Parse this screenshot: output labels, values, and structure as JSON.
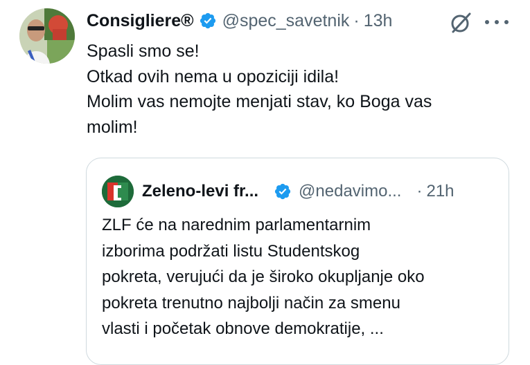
{
  "tweet": {
    "author": {
      "display_name": "Consigliere®",
      "handle": "@spec_savetnik",
      "separator": "·",
      "time": "13h",
      "verified": true,
      "avatar_icon": "profile-photo"
    },
    "text_lines": [
      "Spasli smo se!",
      "Otkad ovih nema u opoziciji idila!",
      "Molim vas nemojte menjati stav, ko Boga vas",
      "molim!"
    ],
    "actions": {
      "grok_icon": "grok-icon",
      "more_icon": "more-icon"
    }
  },
  "quoted_tweet": {
    "author": {
      "display_name": "Zeleno-levi fr...",
      "handle": "@nedavimo...",
      "separator": "·",
      "time": "21h",
      "verified": true,
      "avatar_icon": "zlf-logo"
    },
    "text_lines": [
      "ZLF će na narednim parlamentarnim",
      "izborima podržati listu Studentskog",
      "pokreta, verujući da je široko okupljanje oko",
      "pokreta trenutno najbolji način za smenu",
      "vlasti i početak obnove demokratije, ..."
    ]
  },
  "colors": {
    "text_primary": "#0f1419",
    "text_secondary": "#536471",
    "verified_blue": "#1d9bf0",
    "border": "#cfd9de",
    "zlf_green": "#1e6b3a",
    "zlf_red": "#d9342b"
  }
}
